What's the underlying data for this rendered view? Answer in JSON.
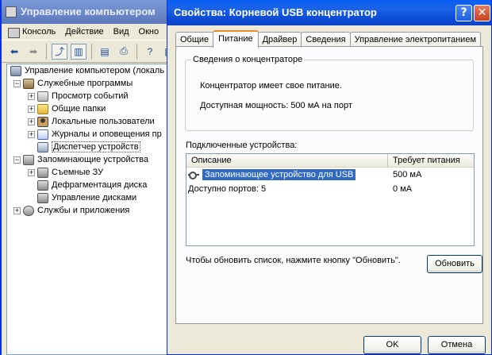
{
  "background_window": {
    "title": "Управление компьютером",
    "menu": [
      "Консоль",
      "Действие",
      "Вид",
      "Окно"
    ],
    "tree": [
      {
        "label": "Управление компьютером (локаль",
        "level": 0,
        "expander": "",
        "icon": "computer-icon"
      },
      {
        "label": "Служебные программы",
        "level": 1,
        "expander": "−",
        "icon": "tools-icon"
      },
      {
        "label": "Просмотр событий",
        "level": 2,
        "expander": "+",
        "icon": "event-log-icon"
      },
      {
        "label": "Общие папки",
        "level": 2,
        "expander": "+",
        "icon": "shared-folder-icon"
      },
      {
        "label": "Локальные пользователи",
        "level": 2,
        "expander": "+",
        "icon": "users-icon"
      },
      {
        "label": "Журналы и оповещения пр",
        "level": 2,
        "expander": "+",
        "icon": "performance-logs-icon"
      },
      {
        "label": "Диспетчер устройств",
        "level": 2,
        "expander": "",
        "icon": "device-manager-icon"
      },
      {
        "label": "Запоминающие устройства",
        "level": 1,
        "expander": "−",
        "icon": "storage-icon"
      },
      {
        "label": "Съемные ЗУ",
        "level": 2,
        "expander": "+",
        "icon": "removable-storage-icon"
      },
      {
        "label": "Дефрагментация диска",
        "level": 2,
        "expander": "",
        "icon": "defrag-icon"
      },
      {
        "label": "Управление дисками",
        "level": 2,
        "expander": "",
        "icon": "disk-management-icon"
      },
      {
        "label": "Службы и приложения",
        "level": 1,
        "expander": "+",
        "icon": "services-icon"
      }
    ]
  },
  "dialog": {
    "title": "Свойства: Корневой USB концентратор",
    "help_glyph": "?",
    "close_glyph": "✕",
    "tabs": [
      "Общие",
      "Питание",
      "Драйвер",
      "Сведения",
      "Управление электропитанием"
    ],
    "active_tab": 1,
    "hub_info": {
      "legend": "Сведения о концентраторе",
      "power_status": "Концентратор имеет свое питание.",
      "available_power": "Доступная мощность:  500 мА на порт"
    },
    "devices_label": "Подключенные устройства:",
    "columns": [
      "Описание",
      "Требует питания"
    ],
    "rows": [
      {
        "description": "Запоминающее устройство для USB",
        "power": "500 мА",
        "selected": true
      },
      {
        "description": "Доступно портов: 5",
        "power": "0 мА",
        "selected": false
      }
    ],
    "hint": "Чтобы обновить список, нажмите кнопку \"Обновить\".",
    "refresh_label": "Обновить",
    "ok_label": "OK",
    "cancel_label": "Отмена"
  }
}
